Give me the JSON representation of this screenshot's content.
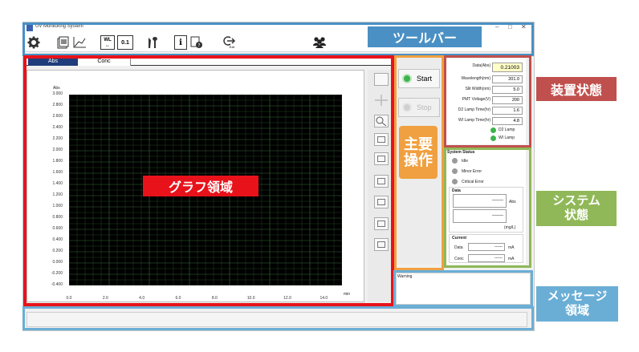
{
  "window": {
    "title": "UV Monitoring System",
    "minimize": "–",
    "maximize": "□",
    "close": "✕"
  },
  "toolbar": {
    "icons": [
      "settings-icon",
      "save-report-icon",
      "graph-axis-icon",
      "wavelength-icon",
      "zero-icon",
      "tools-icon",
      "info-icon",
      "help-icon",
      "exit-icon",
      "users-icon"
    ],
    "wl_text": "WL",
    "zero_text": "0.1",
    "exit_text": "Exit"
  },
  "tabs": {
    "abs": "Abs",
    "conc": "Conc"
  },
  "graph": {
    "y_unit": "Abs",
    "x_unit": "min",
    "y_ticks": [
      "3.000",
      "2.800",
      "2.600",
      "2.400",
      "2.200",
      "2.000",
      "1.800",
      "1.600",
      "1.400",
      "1.200",
      "1.000",
      "0.800",
      "0.600",
      "0.400",
      "0.200",
      "0.000",
      "-0.200",
      "-0.400"
    ],
    "x_ticks": [
      "0.0",
      "2.0",
      "4.0",
      "6.0",
      "8.0",
      "10.0",
      "12.0",
      "14.0"
    ]
  },
  "operations": {
    "start": "Start",
    "stop": "Stop"
  },
  "device": {
    "rows": [
      {
        "label": "Data(Abs)",
        "value": "0.21003"
      },
      {
        "label": "Wavelength(nm)",
        "value": "201.0"
      },
      {
        "label": "Slit Width(nm)",
        "value": "5.0"
      },
      {
        "label": "PMT Voltage(V)",
        "value": "200"
      },
      {
        "label": "D2 Lamp Time(hr)",
        "value": "1.6"
      },
      {
        "label": "WI Lamp Time(hr)",
        "value": "4.8"
      }
    ],
    "d2_lamp": "D2 Lamp",
    "wi_lamp": "WI Lamp"
  },
  "system": {
    "title": "System Status",
    "idle": "Idle",
    "minor_error": "Minor Error",
    "critical_error": "Critical Error",
    "data_title": "Data",
    "data_abs": "-------",
    "abs_unit": "Abs",
    "data_conc": "-------",
    "conc_unit": "(mg/L)",
    "current_title": "Current",
    "current_data_label": "Data",
    "current_data_value": "------",
    "current_conc_label": "Conc",
    "current_conc_value": "------",
    "ma_unit": "mA"
  },
  "message": {
    "label": "Warning"
  },
  "callouts": {
    "toolbar": "ツールバー",
    "device": "装置状態",
    "graph": "グラフ領域",
    "ops": "主要\n操作",
    "system": "システム\n状態",
    "message": "メッセージ\n領域"
  },
  "colors": {
    "accent_blue": "#4a90c4",
    "red": "#e8121a",
    "orange": "#f0a040",
    "device_red": "#c0504d",
    "green": "#90b858",
    "message_blue": "#6aaed6",
    "grid_green": "#3a6a3a",
    "led_green": "#3cb44b",
    "led_grey": "#9a9a9a"
  }
}
